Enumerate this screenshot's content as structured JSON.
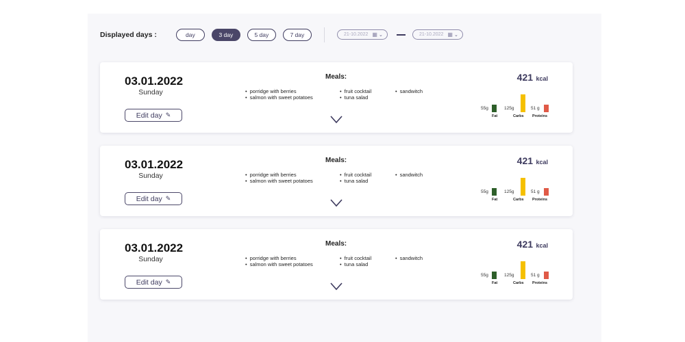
{
  "filter": {
    "label": "Displayed days :",
    "options": [
      "day",
      "3 day",
      "5 day",
      "7 day"
    ],
    "selected": "3 day",
    "date_from": "21-10.2022",
    "date_to": "21-10.2022"
  },
  "colors": {
    "accent": "#4a4668",
    "fat": "#2e5f2a",
    "carbs": "#f5c000",
    "proteins": "#e05a47"
  },
  "days": [
    {
      "date": "03.01.2022",
      "weekday": "Sunday",
      "edit_label": "Edit day",
      "meals_title": "Meals:",
      "meals": [
        "porridge with berries",
        "salmon with sweet potatoes",
        "fruit cocktail",
        "tuna salad",
        "sandwitch"
      ],
      "kcal": "421",
      "kcal_unit": "kcal",
      "macros": [
        {
          "name": "Fat",
          "value": "55g",
          "amount": 55
        },
        {
          "name": "Carbs",
          "value": "125g",
          "amount": 125
        },
        {
          "name": "Proteins",
          "value": "51 g",
          "amount": 51
        }
      ]
    },
    {
      "date": "03.01.2022",
      "weekday": "Sunday",
      "edit_label": "Edit day",
      "meals_title": "Meals:",
      "meals": [
        "porridge with berries",
        "salmon with sweet potatoes",
        "fruit cocktail",
        "tuna salad",
        "sandwitch"
      ],
      "kcal": "421",
      "kcal_unit": "kcal",
      "macros": [
        {
          "name": "Fat",
          "value": "55g",
          "amount": 55
        },
        {
          "name": "Carbs",
          "value": "125g",
          "amount": 125
        },
        {
          "name": "Proteins",
          "value": "51 g",
          "amount": 51
        }
      ]
    },
    {
      "date": "03.01.2022",
      "weekday": "Sunday",
      "edit_label": "Edit day",
      "meals_title": "Meals:",
      "meals": [
        "porridge with berries",
        "salmon with sweet potatoes",
        "fruit cocktail",
        "tuna salad",
        "sandwitch"
      ],
      "kcal": "421",
      "kcal_unit": "kcal",
      "macros": [
        {
          "name": "Fat",
          "value": "55g",
          "amount": 55
        },
        {
          "name": "Carbs",
          "value": "125g",
          "amount": 125
        },
        {
          "name": "Proteins",
          "value": "51 g",
          "amount": 51
        }
      ]
    }
  ]
}
